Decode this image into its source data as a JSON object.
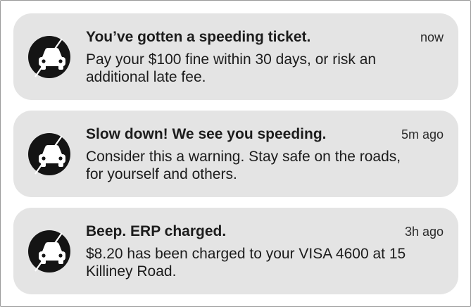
{
  "notifications": [
    {
      "app_icon": "car-icon",
      "title": "You’ve gotten a speeding ticket.",
      "time": "now",
      "body": "Pay your $100 fine within 30 days, or risk an additional late fee."
    },
    {
      "app_icon": "car-icon",
      "title": "Slow down! We see you speeding.",
      "time": "5m ago",
      "body": "Consider this a warning. Stay safe on the roads, for yourself and others."
    },
    {
      "app_icon": "car-icon",
      "title": "Beep. ERP charged.",
      "time": "3h ago",
      "body": "$8.20 has been charged to your VISA 4600 at 15 Killiney Road."
    }
  ],
  "colors": {
    "card_background": "#e4e4e4",
    "icon_background": "#141414",
    "icon_foreground": "#ffffff"
  }
}
